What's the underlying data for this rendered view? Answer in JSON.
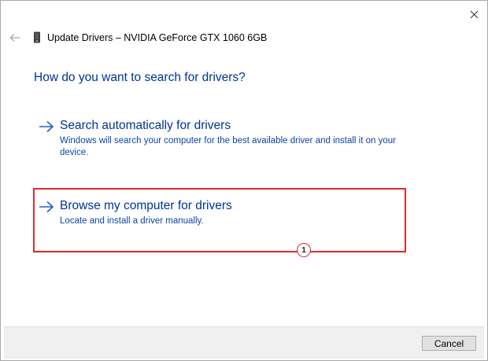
{
  "window": {
    "title": "Update Drivers – NVIDIA GeForce GTX 1060 6GB",
    "close_icon": "close-icon",
    "back_icon": "back-arrow-icon",
    "device_icon": "display-adapter-icon"
  },
  "main": {
    "heading": "How do you want to search for drivers?",
    "options": [
      {
        "title": "Search automatically for drivers",
        "description": "Windows will search your computer for the best available driver and install it on your device.",
        "icon": "arrow-right-icon"
      },
      {
        "title": "Browse my computer for drivers",
        "description": "Locate and install a driver manually.",
        "icon": "arrow-right-icon"
      }
    ]
  },
  "annotation": {
    "step_number": "1",
    "box_color": "#e0292f"
  },
  "footer": {
    "cancel_label": "Cancel"
  },
  "colors": {
    "link_blue": "#003399",
    "desc_blue": "#0e44a8",
    "footer_bg": "#f0f0f0"
  }
}
